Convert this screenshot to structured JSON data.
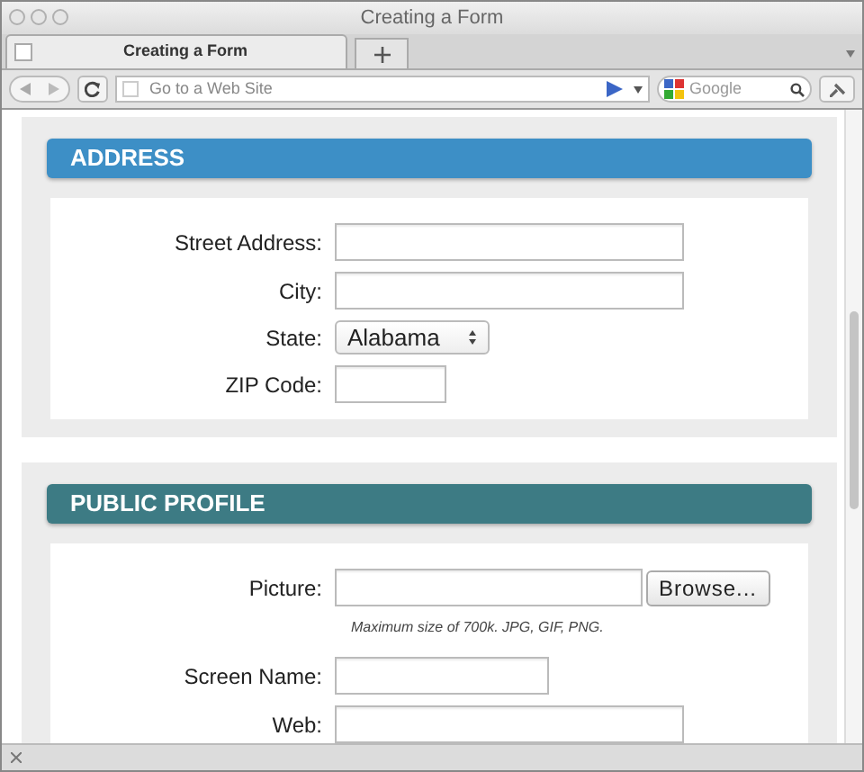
{
  "window": {
    "title": "Creating a Form"
  },
  "tabs": [
    {
      "label": "Creating a Form",
      "selected": true
    }
  ],
  "toolbar": {
    "address_placeholder": "Go to a Web Site",
    "search_placeholder": "Google"
  },
  "sections": [
    {
      "title": "ADDRESS",
      "color": "#3d8fc6",
      "fields": [
        {
          "kind": "text",
          "label": "Street Address:"
        },
        {
          "kind": "text",
          "label": "City:"
        },
        {
          "kind": "select",
          "label": "State:",
          "value": "Alabama"
        },
        {
          "kind": "short",
          "label": "ZIP Code:"
        }
      ]
    },
    {
      "title": "PUBLIC PROFILE",
      "color": "#3d7b84",
      "fields": [
        {
          "kind": "file",
          "label": "Picture:",
          "button": "Browse...",
          "hint": "Maximum size of 700k. JPG, GIF, PNG."
        },
        {
          "kind": "medium",
          "label": "Screen Name:"
        },
        {
          "kind": "text",
          "label": "Web:"
        }
      ]
    }
  ]
}
